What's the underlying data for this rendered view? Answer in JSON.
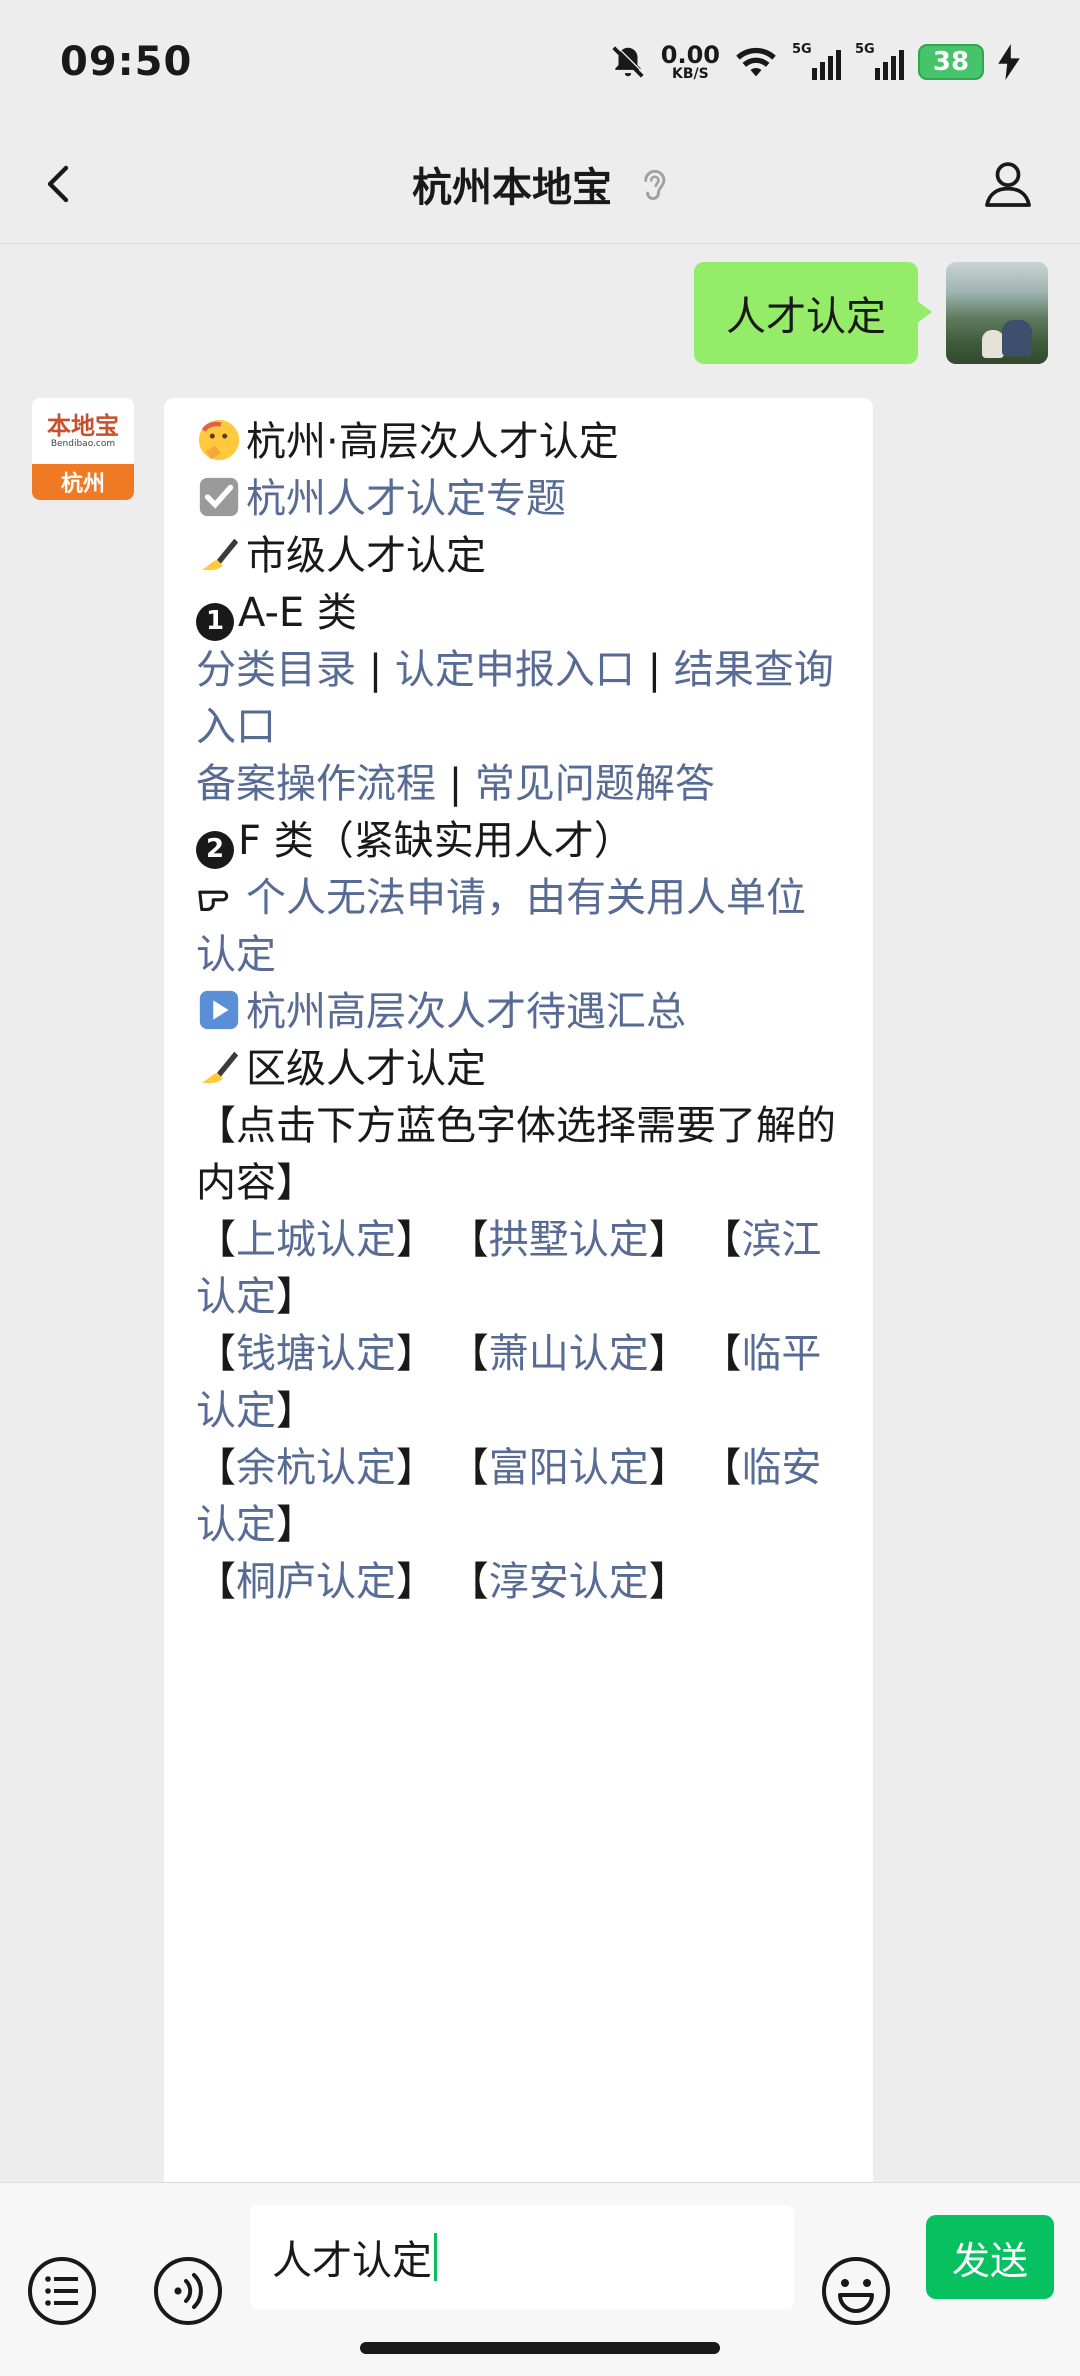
{
  "status": {
    "time": "09:50",
    "net_value": "0.00",
    "net_unit": "KB/S",
    "sig1": "5G",
    "sig2": "5G",
    "battery": "38"
  },
  "nav": {
    "title": "杭州本地宝"
  },
  "chat": {
    "user_message": "人才认定",
    "bot_avatar": {
      "brand": "本地宝",
      "domain": "Bendibao.com",
      "city": "杭州"
    },
    "bot": {
      "title": "杭州·高层次人才认定",
      "topic_link": "杭州人才认定专题",
      "city_level_heading": "市级人才认定",
      "ae_num": "1",
      "ae_heading": "A-E 类",
      "link_catalog": "分类目录",
      "sep": "|",
      "link_apply": "认定申报入口",
      "link_result": "结果查询入口",
      "link_filing": "备案操作流程",
      "link_faq": "常见问题解答",
      "f_num": "2",
      "f_heading": "F 类（紧缺实用人才）",
      "f_note": "个人无法申请，由有关用人单位认定",
      "benefits_link": "杭州高层次人才待遇汇总",
      "district_heading": "区级人才认定",
      "district_note": "【点击下方蓝色字体选择需要了解的内容】",
      "lb": "【",
      "rb": "】",
      "districts": [
        "上城认定",
        "拱墅认定",
        "滨江认定",
        "钱塘认定",
        "萧山认定",
        "临平认定",
        "余杭认定",
        "富阳认定",
        "临安认定",
        "桐庐认定",
        "淳安认定"
      ]
    }
  },
  "input": {
    "value": "人才认定",
    "send_label": "发送"
  },
  "colors": {
    "send": "#07c160",
    "user_bubble": "#95ec69",
    "link": "#576b95"
  }
}
